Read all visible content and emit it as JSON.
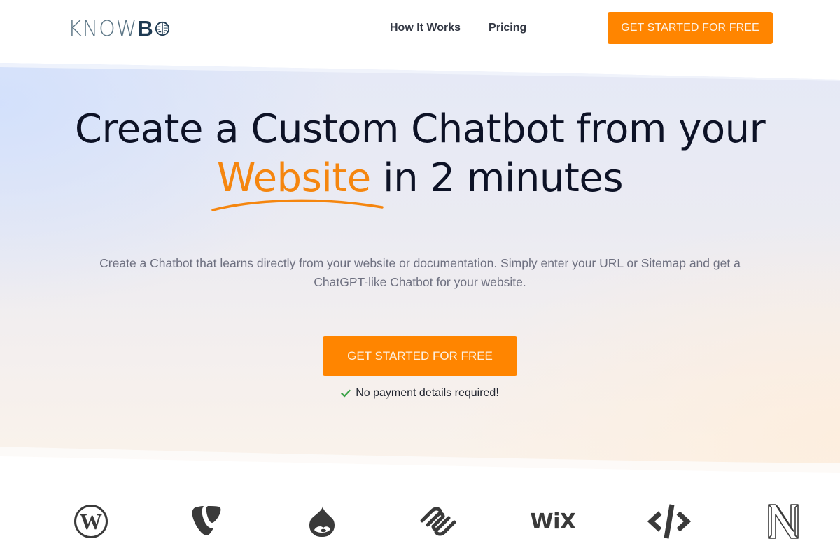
{
  "header": {
    "logo": {
      "text_light": "KNOW",
      "text_bold": "B",
      "icon": "brain-icon"
    },
    "nav": [
      {
        "label": "How It Works"
      },
      {
        "label": "Pricing"
      }
    ],
    "cta_label": "GET STARTED FOR FREE"
  },
  "hero": {
    "headline_line1": "Create a Custom Chatbot from your",
    "headline_accent": "Website",
    "headline_line2_rest": " in 2 minutes",
    "subtitle": "Create a Chatbot that learns directly from your website or documentation. Simply enter your URL or Sitemap and get a ChatGPT-like Chatbot for your website.",
    "cta_label": "GET STARTED FOR FREE",
    "note": "No payment details required!",
    "note_icon": "check-icon"
  },
  "integrations": [
    {
      "name": "WordPress",
      "icon": "wordpress-icon"
    },
    {
      "name": "TYPO3",
      "icon": "typo3-icon"
    },
    {
      "name": "Drupal",
      "icon": "drupal-icon"
    },
    {
      "name": "Squarespace",
      "icon": "squarespace-icon"
    },
    {
      "name": "Wix",
      "icon": "wix-icon",
      "label": "WiX"
    },
    {
      "name": "Custom HTML",
      "icon": "code-icon"
    },
    {
      "name": "Nuxt / N",
      "icon": "n-logo-icon"
    }
  ],
  "colors": {
    "brand_orange": "#ff8500",
    "accent_text": "#f5860f",
    "headline": "#0d1226",
    "icon_dark": "#3a3a3a",
    "check_green": "#3ea34a"
  }
}
